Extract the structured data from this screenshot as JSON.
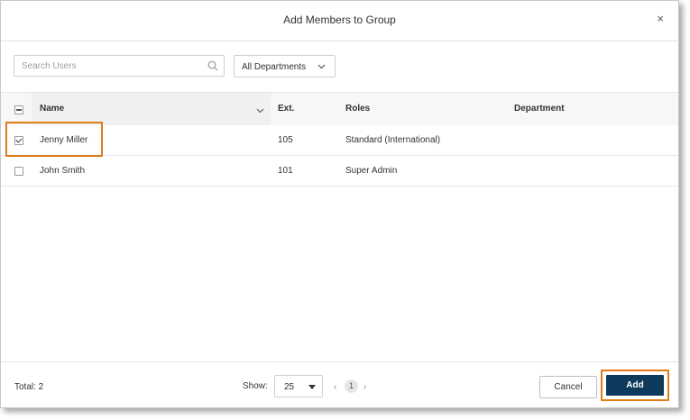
{
  "dialog": {
    "title": "Add Members to Group",
    "close_icon": "×"
  },
  "toolbar": {
    "search_placeholder": "Search Users",
    "search_value": "",
    "department_selected": "All Departments"
  },
  "table": {
    "columns": [
      "Name",
      "Ext.",
      "Roles",
      "Department"
    ],
    "rows": [
      {
        "name": "Jenny Miller",
        "ext": "105",
        "role": "Standard (International)",
        "department": "",
        "checked": true
      },
      {
        "name": "John Smith",
        "ext": "101",
        "role": "Super Admin",
        "department": "",
        "checked": false
      }
    ]
  },
  "footer": {
    "total": "Total: 2",
    "show_label": "Show:",
    "page_size": "25",
    "prev": "‹",
    "current_page": "1",
    "next": "›",
    "cancel_label": "Cancel",
    "add_label": "Add"
  },
  "colors": {
    "highlight": "#e07b1a",
    "primary_button": "#0d3a5c"
  }
}
